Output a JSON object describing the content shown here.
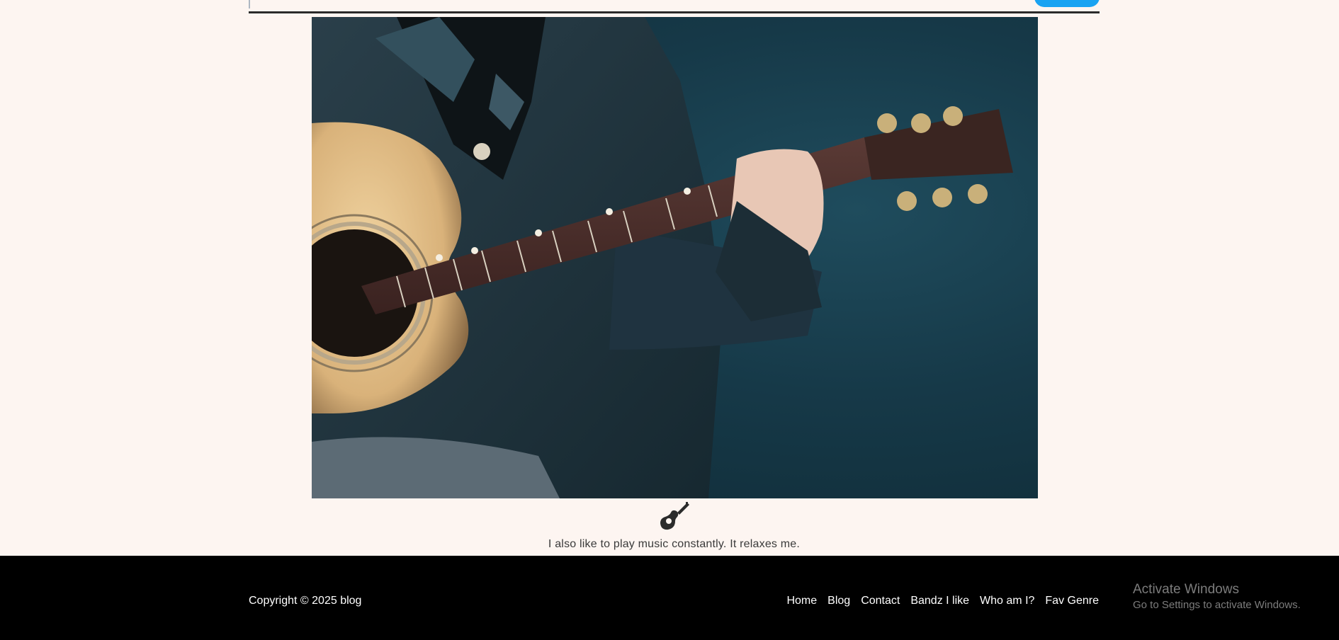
{
  "header": {
    "search_input_value": "",
    "search_button_label": ""
  },
  "hero": {
    "image_alt": "Person in leather jacket playing acoustic guitar"
  },
  "icons": {
    "guitar": "guitar-icon"
  },
  "content": {
    "caption": "I also like to play music constantly. It relaxes me."
  },
  "footer": {
    "copyright": "Copyright © 2025 blog",
    "nav": [
      {
        "label": "Home"
      },
      {
        "label": "Blog"
      },
      {
        "label": "Contact"
      },
      {
        "label": "Bandz I like"
      },
      {
        "label": "Who am I?"
      },
      {
        "label": "Fav Genre"
      }
    ]
  },
  "os_overlay": {
    "title": "Activate Windows",
    "subtitle": "Go to Settings to activate Windows."
  },
  "colors": {
    "page_bg": "#fdf5f1",
    "footer_bg": "#000000",
    "accent": "#1aa3f2"
  }
}
